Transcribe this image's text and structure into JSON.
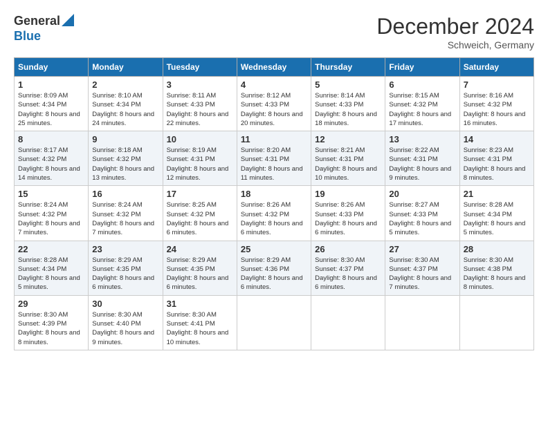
{
  "header": {
    "logo_line1": "General",
    "logo_line2": "Blue",
    "month_title": "December 2024",
    "subtitle": "Schweich, Germany"
  },
  "days_of_week": [
    "Sunday",
    "Monday",
    "Tuesday",
    "Wednesday",
    "Thursday",
    "Friday",
    "Saturday"
  ],
  "weeks": [
    [
      {
        "day": "1",
        "sunrise": "Sunrise: 8:09 AM",
        "sunset": "Sunset: 4:34 PM",
        "daylight": "Daylight: 8 hours and 25 minutes."
      },
      {
        "day": "2",
        "sunrise": "Sunrise: 8:10 AM",
        "sunset": "Sunset: 4:34 PM",
        "daylight": "Daylight: 8 hours and 24 minutes."
      },
      {
        "day": "3",
        "sunrise": "Sunrise: 8:11 AM",
        "sunset": "Sunset: 4:33 PM",
        "daylight": "Daylight: 8 hours and 22 minutes."
      },
      {
        "day": "4",
        "sunrise": "Sunrise: 8:12 AM",
        "sunset": "Sunset: 4:33 PM",
        "daylight": "Daylight: 8 hours and 20 minutes."
      },
      {
        "day": "5",
        "sunrise": "Sunrise: 8:14 AM",
        "sunset": "Sunset: 4:33 PM",
        "daylight": "Daylight: 8 hours and 18 minutes."
      },
      {
        "day": "6",
        "sunrise": "Sunrise: 8:15 AM",
        "sunset": "Sunset: 4:32 PM",
        "daylight": "Daylight: 8 hours and 17 minutes."
      },
      {
        "day": "7",
        "sunrise": "Sunrise: 8:16 AM",
        "sunset": "Sunset: 4:32 PM",
        "daylight": "Daylight: 8 hours and 16 minutes."
      }
    ],
    [
      {
        "day": "8",
        "sunrise": "Sunrise: 8:17 AM",
        "sunset": "Sunset: 4:32 PM",
        "daylight": "Daylight: 8 hours and 14 minutes."
      },
      {
        "day": "9",
        "sunrise": "Sunrise: 8:18 AM",
        "sunset": "Sunset: 4:32 PM",
        "daylight": "Daylight: 8 hours and 13 minutes."
      },
      {
        "day": "10",
        "sunrise": "Sunrise: 8:19 AM",
        "sunset": "Sunset: 4:31 PM",
        "daylight": "Daylight: 8 hours and 12 minutes."
      },
      {
        "day": "11",
        "sunrise": "Sunrise: 8:20 AM",
        "sunset": "Sunset: 4:31 PM",
        "daylight": "Daylight: 8 hours and 11 minutes."
      },
      {
        "day": "12",
        "sunrise": "Sunrise: 8:21 AM",
        "sunset": "Sunset: 4:31 PM",
        "daylight": "Daylight: 8 hours and 10 minutes."
      },
      {
        "day": "13",
        "sunrise": "Sunrise: 8:22 AM",
        "sunset": "Sunset: 4:31 PM",
        "daylight": "Daylight: 8 hours and 9 minutes."
      },
      {
        "day": "14",
        "sunrise": "Sunrise: 8:23 AM",
        "sunset": "Sunset: 4:31 PM",
        "daylight": "Daylight: 8 hours and 8 minutes."
      }
    ],
    [
      {
        "day": "15",
        "sunrise": "Sunrise: 8:24 AM",
        "sunset": "Sunset: 4:32 PM",
        "daylight": "Daylight: 8 hours and 7 minutes."
      },
      {
        "day": "16",
        "sunrise": "Sunrise: 8:24 AM",
        "sunset": "Sunset: 4:32 PM",
        "daylight": "Daylight: 8 hours and 7 minutes."
      },
      {
        "day": "17",
        "sunrise": "Sunrise: 8:25 AM",
        "sunset": "Sunset: 4:32 PM",
        "daylight": "Daylight: 8 hours and 6 minutes."
      },
      {
        "day": "18",
        "sunrise": "Sunrise: 8:26 AM",
        "sunset": "Sunset: 4:32 PM",
        "daylight": "Daylight: 8 hours and 6 minutes."
      },
      {
        "day": "19",
        "sunrise": "Sunrise: 8:26 AM",
        "sunset": "Sunset: 4:33 PM",
        "daylight": "Daylight: 8 hours and 6 minutes."
      },
      {
        "day": "20",
        "sunrise": "Sunrise: 8:27 AM",
        "sunset": "Sunset: 4:33 PM",
        "daylight": "Daylight: 8 hours and 5 minutes."
      },
      {
        "day": "21",
        "sunrise": "Sunrise: 8:28 AM",
        "sunset": "Sunset: 4:34 PM",
        "daylight": "Daylight: 8 hours and 5 minutes."
      }
    ],
    [
      {
        "day": "22",
        "sunrise": "Sunrise: 8:28 AM",
        "sunset": "Sunset: 4:34 PM",
        "daylight": "Daylight: 8 hours and 5 minutes."
      },
      {
        "day": "23",
        "sunrise": "Sunrise: 8:29 AM",
        "sunset": "Sunset: 4:35 PM",
        "daylight": "Daylight: 8 hours and 6 minutes."
      },
      {
        "day": "24",
        "sunrise": "Sunrise: 8:29 AM",
        "sunset": "Sunset: 4:35 PM",
        "daylight": "Daylight: 8 hours and 6 minutes."
      },
      {
        "day": "25",
        "sunrise": "Sunrise: 8:29 AM",
        "sunset": "Sunset: 4:36 PM",
        "daylight": "Daylight: 8 hours and 6 minutes."
      },
      {
        "day": "26",
        "sunrise": "Sunrise: 8:30 AM",
        "sunset": "Sunset: 4:37 PM",
        "daylight": "Daylight: 8 hours and 6 minutes."
      },
      {
        "day": "27",
        "sunrise": "Sunrise: 8:30 AM",
        "sunset": "Sunset: 4:37 PM",
        "daylight": "Daylight: 8 hours and 7 minutes."
      },
      {
        "day": "28",
        "sunrise": "Sunrise: 8:30 AM",
        "sunset": "Sunset: 4:38 PM",
        "daylight": "Daylight: 8 hours and 8 minutes."
      }
    ],
    [
      {
        "day": "29",
        "sunrise": "Sunrise: 8:30 AM",
        "sunset": "Sunset: 4:39 PM",
        "daylight": "Daylight: 8 hours and 8 minutes."
      },
      {
        "day": "30",
        "sunrise": "Sunrise: 8:30 AM",
        "sunset": "Sunset: 4:40 PM",
        "daylight": "Daylight: 8 hours and 9 minutes."
      },
      {
        "day": "31",
        "sunrise": "Sunrise: 8:30 AM",
        "sunset": "Sunset: 4:41 PM",
        "daylight": "Daylight: 8 hours and 10 minutes."
      },
      null,
      null,
      null,
      null
    ]
  ]
}
